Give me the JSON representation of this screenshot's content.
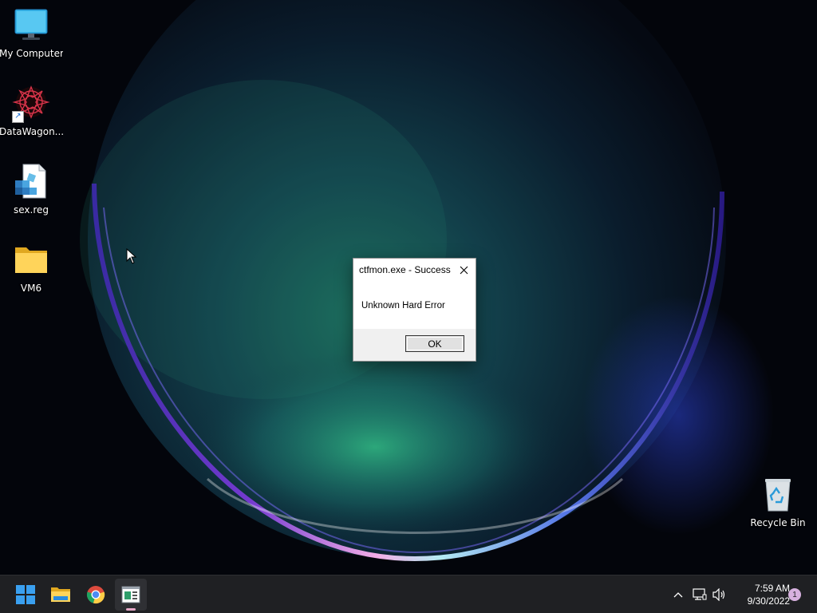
{
  "desktop": {
    "icons": [
      {
        "label": "My Computer",
        "icon": "monitor-icon"
      },
      {
        "label": "DataWagon...",
        "icon": "datawagon-icon"
      },
      {
        "label": "sex.reg",
        "icon": "registry-file-icon"
      },
      {
        "label": "VM6",
        "icon": "folder-icon"
      },
      {
        "label": "Recycle Bin",
        "icon": "recycle-bin-icon"
      }
    ]
  },
  "dialog": {
    "title": "ctfmon.exe - Success",
    "message": "Unknown Hard Error",
    "ok_label": "OK"
  },
  "taskbar": {
    "apps": [
      "windows-start-icon",
      "file-explorer-icon",
      "chrome-icon",
      "active-window-icon"
    ],
    "time": "7:59 AM",
    "date": "9/30/2022",
    "notification_count": "1"
  },
  "colors": {
    "taskbar_bg": "#1f2023",
    "dialog_footer": "#f0f0f0",
    "accent_start": "#3aa0f0"
  }
}
